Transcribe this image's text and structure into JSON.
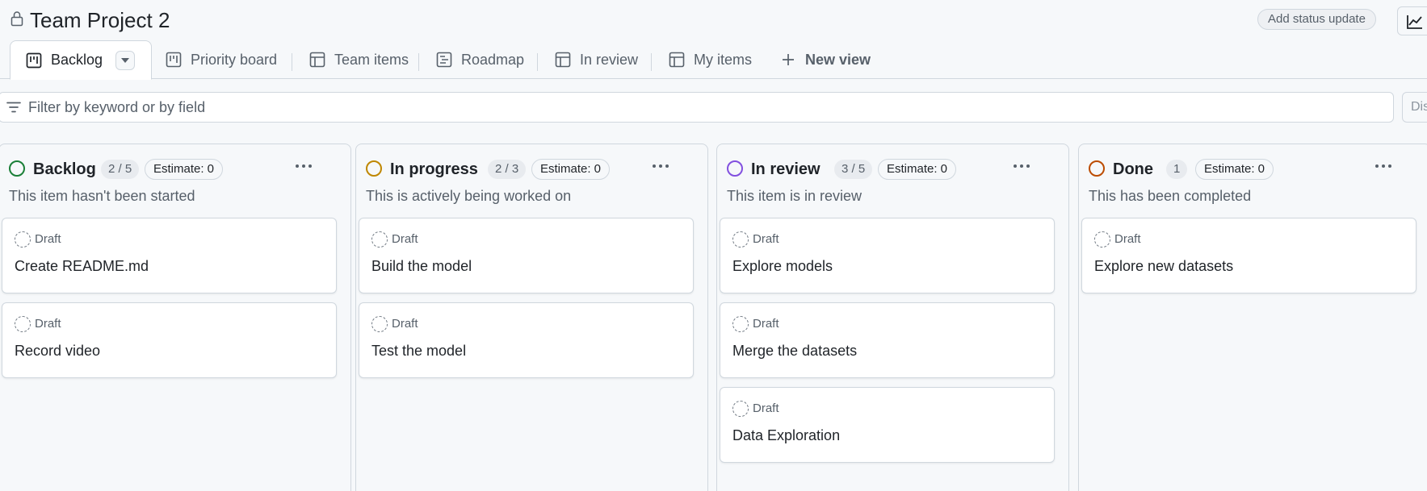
{
  "header": {
    "title": "Team Project 2",
    "status_button": "Add status update"
  },
  "tabs": [
    {
      "label": "Backlog",
      "icon": "board-icon",
      "active": true
    },
    {
      "label": "Priority board",
      "icon": "board-icon"
    },
    {
      "label": "Team items",
      "icon": "table-icon"
    },
    {
      "label": "Roadmap",
      "icon": "roadmap-icon"
    },
    {
      "label": "In review",
      "icon": "table-icon"
    },
    {
      "label": "My items",
      "icon": "table-icon"
    },
    {
      "label": "New view",
      "icon": "plus-icon"
    }
  ],
  "filter": {
    "placeholder": "Filter by keyword or by field",
    "discard_label": "Discard"
  },
  "columns": [
    {
      "title": "Backlog",
      "count": "2 / 5",
      "estimate": "Estimate: 0",
      "description": "This item hasn't been started",
      "status_color": "#1a7f37",
      "cards": [
        {
          "type": "Draft",
          "title": "Create README.md"
        },
        {
          "type": "Draft",
          "title": "Record video"
        }
      ]
    },
    {
      "title": "In progress",
      "count": "2 / 3",
      "estimate": "Estimate: 0",
      "description": "This is actively being worked on",
      "status_color": "#bf8700",
      "cards": [
        {
          "type": "Draft",
          "title": "Build the model"
        },
        {
          "type": "Draft",
          "title": "Test the model"
        }
      ]
    },
    {
      "title": "In review",
      "count": "3 / 5",
      "estimate": "Estimate: 0",
      "description": "This item is in review",
      "status_color": "#8250df",
      "cards": [
        {
          "type": "Draft",
          "title": "Explore models"
        },
        {
          "type": "Draft",
          "title": "Merge the datasets"
        },
        {
          "type": "Draft",
          "title": "Data Exploration"
        }
      ]
    },
    {
      "title": "Done",
      "count": "1",
      "estimate": "Estimate: 0",
      "description": "This has been completed",
      "status_color": "#bc4c00",
      "cards": [
        {
          "type": "Draft",
          "title": "Explore new datasets"
        }
      ]
    }
  ]
}
